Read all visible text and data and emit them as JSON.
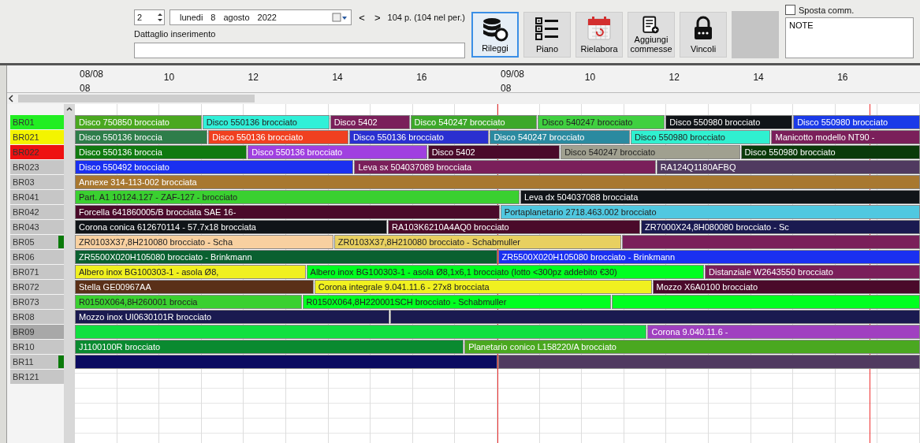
{
  "toolbar": {
    "spinner": {
      "value": "2"
    },
    "date": {
      "weekday": "lunedi",
      "day": "8",
      "month": "agosto",
      "year": "2022"
    },
    "nav": {
      "prev": "<",
      "next": ">"
    },
    "count": "104 p. (104 nel per.)",
    "detail_label": "Dattaglio inserimento",
    "buttons": [
      {
        "label": "Rileggi",
        "selected": true
      },
      {
        "label": "Piano",
        "selected": false
      },
      {
        "label": "Rielabora",
        "selected": false
      },
      {
        "label": "Aggiungi commesse",
        "selected": false
      },
      {
        "label": "Vincoli",
        "selected": false
      }
    ],
    "move_option": {
      "label": "Sposta comm.",
      "checked": false
    },
    "notes": {
      "value": "NOTE"
    }
  },
  "timeline": {
    "days": [
      {
        "date": "08/08",
        "hour": "08",
        "ticks": [
          "10",
          "12",
          "14",
          "16"
        ]
      },
      {
        "date": "09/08",
        "hour": "08",
        "ticks": [
          "10",
          "12",
          "14",
          "16"
        ]
      }
    ]
  },
  "resources": [
    {
      "name": "BR01",
      "color": "#22ee22",
      "flagged": false,
      "selected": false
    },
    {
      "name": "BR021",
      "color": "#f4f400",
      "flagged": false,
      "selected": false
    },
    {
      "name": "BR022",
      "color": "#ee1111",
      "flagged": false,
      "selected": false
    },
    {
      "name": "BR023",
      "color": "#c6c6c6",
      "flagged": false,
      "selected": false
    },
    {
      "name": "BR03",
      "color": "#c6c6c6",
      "flagged": false,
      "selected": false
    },
    {
      "name": "BR041",
      "color": "#c6c6c6",
      "flagged": false,
      "selected": false
    },
    {
      "name": "BR042",
      "color": "#c6c6c6",
      "flagged": false,
      "selected": false
    },
    {
      "name": "BR043",
      "color": "#c6c6c6",
      "flagged": false,
      "selected": false
    },
    {
      "name": "BR05",
      "color": "#c6c6c6",
      "flagged": true,
      "selected": false
    },
    {
      "name": "BR06",
      "color": "#c6c6c6",
      "flagged": false,
      "selected": false
    },
    {
      "name": "BR071",
      "color": "#c6c6c6",
      "flagged": false,
      "selected": false
    },
    {
      "name": "BR072",
      "color": "#c6c6c6",
      "flagged": false,
      "selected": false
    },
    {
      "name": "BR073",
      "color": "#c6c6c6",
      "flagged": false,
      "selected": false
    },
    {
      "name": "BR08",
      "color": "#c6c6c6",
      "flagged": false,
      "selected": false
    },
    {
      "name": "BR09",
      "color": "#a8a8a8",
      "flagged": false,
      "selected": false
    },
    {
      "name": "BR10",
      "color": "#c6c6c6",
      "flagged": false,
      "selected": false
    },
    {
      "name": "BR11",
      "color": "#c6c6c6",
      "flagged": true,
      "selected": false
    },
    {
      "name": "BR121",
      "color": "#c6c6c6",
      "flagged": false,
      "selected": false
    }
  ],
  "rows": [
    {
      "bars": [
        {
          "label": "Disco 750850 brocciato",
          "color": "#4aa820"
        },
        {
          "label": "Disco 550136 brocciato",
          "color": "#30f0d8"
        },
        {
          "label": "Disco 5402",
          "color": "#7a1f5a"
        },
        {
          "label": "Disco 540247 brocciato",
          "color": "#3da82a"
        },
        {
          "label": "Disco 540247 brocciato",
          "color": "#40d040"
        },
        {
          "label": "Disco 550980 brocciato",
          "color": "#101418"
        },
        {
          "label": "Disco 550980 brocciato",
          "color": "#1a3ae8"
        }
      ]
    },
    {
      "bars": [
        {
          "label": "Disco 550136 broccia",
          "color": "#2e7d4a"
        },
        {
          "label": "Disco 550136 brocciato",
          "color": "#f04020"
        },
        {
          "label": "Disco 550136 brocciato",
          "color": "#2a30d0"
        },
        {
          "label": "Disco 540247 brocciato",
          "color": "#2a8aa0"
        },
        {
          "label": "Disco 550980 brocciato",
          "color": "#30f0d0"
        },
        {
          "label": "Manicotto modello NT90 -",
          "color": "#7a1f5a"
        }
      ]
    },
    {
      "bars": [
        {
          "label": "Disco 550136 broccia",
          "color": "#107a10"
        },
        {
          "label": "Disco 550136 brocciato",
          "color": "#a040e0"
        },
        {
          "label": "Disco 5402",
          "color": "#4a0a2a"
        },
        {
          "label": "Disco 540247 brocciato",
          "color": "#a0a090"
        },
        {
          "label": "Disco 550980 brocciato",
          "color": "#0a3a0a"
        }
      ]
    },
    {
      "bars": [
        {
          "label": "Disco 550492 brocciato",
          "color": "#1a30f0"
        },
        {
          "label": "Leva sx 504037089 brocciata",
          "color": "#7a1f5a"
        },
        {
          "label": "RA124Q1180AFBQ",
          "color": "#503a60"
        }
      ]
    },
    {
      "bars": [
        {
          "label": "Annexe 314-113-002 brocciata",
          "color": "#a87830"
        }
      ]
    },
    {
      "bars": [
        {
          "label": "Part. A1 10124.127 - ZAF-127 - brocciato",
          "color": "#3ad030"
        },
        {
          "label": "Leva dx 504037088 brocciata",
          "color": "#101418"
        }
      ]
    },
    {
      "bars": [
        {
          "label": "Forcella 641860005/B brocciata SAE 16-",
          "color": "#4a0a2a"
        },
        {
          "label": "Portaplanetario 2718.463.002 brocciato",
          "color": "#50c8e0"
        }
      ]
    },
    {
      "bars": [
        {
          "label": "Corona conica 612670114 - 57.7x18 brocciata",
          "color": "#101418"
        },
        {
          "label": "RA103K6210A4AQ0 brocciato",
          "color": "#4a0a2a"
        },
        {
          "label": "ZR7000X24,8H080080 brocciato - Sc",
          "color": "#1a1a50"
        }
      ]
    },
    {
      "bars": [
        {
          "label": "ZR0103X37,8H210080 brocciato - Scha",
          "color": "#f8d0a0"
        },
        {
          "label": "ZR0103X37,8H210080 brocciato - Schabmuller",
          "color": "#e8d060"
        },
        {
          "color": "#7a1f5a"
        }
      ]
    },
    {
      "bars": [
        {
          "label": "ZR5500X020H105080 brocciato - Brinkmann",
          "color": "#0a6030"
        },
        {
          "label": "ZR5500X020H105080 brocciato - Brinkmann",
          "color": "#1a30f0"
        }
      ]
    },
    {
      "bars": [
        {
          "label": "Albero inox BG100303-1 - asola Ø8,",
          "color": "#f0f020"
        },
        {
          "label": "Albero inox BG100303-1 - asola Ø8,1x6,1 brocciato (lotto <300pz addebito €30)",
          "color": "#00ff20"
        },
        {
          "label": "Distanziale W2643550 brocciato",
          "color": "#7a1f5a"
        }
      ]
    },
    {
      "bars": [
        {
          "label": "Stella GE00967AA",
          "color": "#5a3018"
        },
        {
          "label": "Corona integrale 9.041.11.6 - 27x8 brocciata",
          "color": "#f0f020"
        },
        {
          "label": "Mozzo X6A0100 brocciato",
          "color": "#4a0a2a"
        }
      ]
    },
    {
      "bars": [
        {
          "label": "R0150X064,8H260001 broccia",
          "color": "#3ad030"
        },
        {
          "label": "R0150X064,8H220001SCH brocciato - Schabmuller",
          "color": "#00ff20"
        },
        {
          "color": "#00ff20"
        }
      ]
    },
    {
      "bars": [
        {
          "label": "Mozzo inox UI0630101R brocciato",
          "color": "#1a1a50"
        },
        {
          "color": "#1a1a50"
        }
      ]
    },
    {
      "bars": [
        {
          "color": "#10e040"
        },
        {
          "label": "Corona 9.040.11.6 -",
          "color": "#a040c0"
        }
      ]
    },
    {
      "bars": [
        {
          "label": "J1100100R brocciato",
          "color": "#0a8a30"
        },
        {
          "label": "Planetario conico L158220/A brocciato",
          "color": "#4aa820"
        }
      ]
    },
    {
      "bars": [
        {
          "color": "#0a0a60"
        },
        {
          "color": "#503a60"
        }
      ]
    }
  ]
}
